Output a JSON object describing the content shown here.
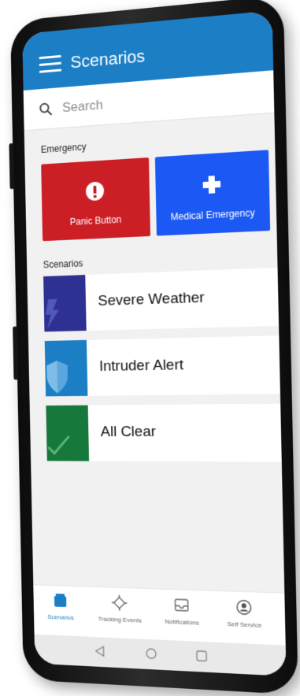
{
  "header": {
    "title": "Scenarios",
    "menu_icon": "hamburger-menu-icon"
  },
  "search": {
    "placeholder": "Search",
    "icon": "search-icon"
  },
  "emergency": {
    "section_label": "Emergency",
    "tiles": [
      {
        "label": "Panic Button",
        "icon": "alert-circle-icon",
        "color": "#cc1e25"
      },
      {
        "label": "Medical Emergency",
        "icon": "medical-cross-icon",
        "color": "#1c58f3"
      }
    ]
  },
  "scenarios": {
    "section_label": "Scenarios",
    "items": [
      {
        "label": "Severe Weather",
        "icon": "lightning-icon",
        "color": "#2e3192"
      },
      {
        "label": "Intruder Alert",
        "icon": "shield-icon",
        "color": "#1c7ec4"
      },
      {
        "label": "All Clear",
        "icon": "checkmark-icon",
        "color": "#17783b"
      }
    ]
  },
  "bottom_nav": {
    "items": [
      {
        "label": "Scenarios",
        "icon": "scenarios-icon",
        "active": true
      },
      {
        "label": "Tracking Events",
        "icon": "crosshair-icon",
        "active": false
      },
      {
        "label": "Notifications",
        "icon": "inbox-icon",
        "active": false
      },
      {
        "label": "Self Service",
        "icon": "user-circle-icon",
        "active": false
      }
    ]
  },
  "system_nav": {
    "icons": [
      "back-triangle-icon",
      "home-circle-icon",
      "recents-square-icon"
    ]
  },
  "colors": {
    "accent": "#1c7ec4",
    "background": "#f1f1f1"
  }
}
